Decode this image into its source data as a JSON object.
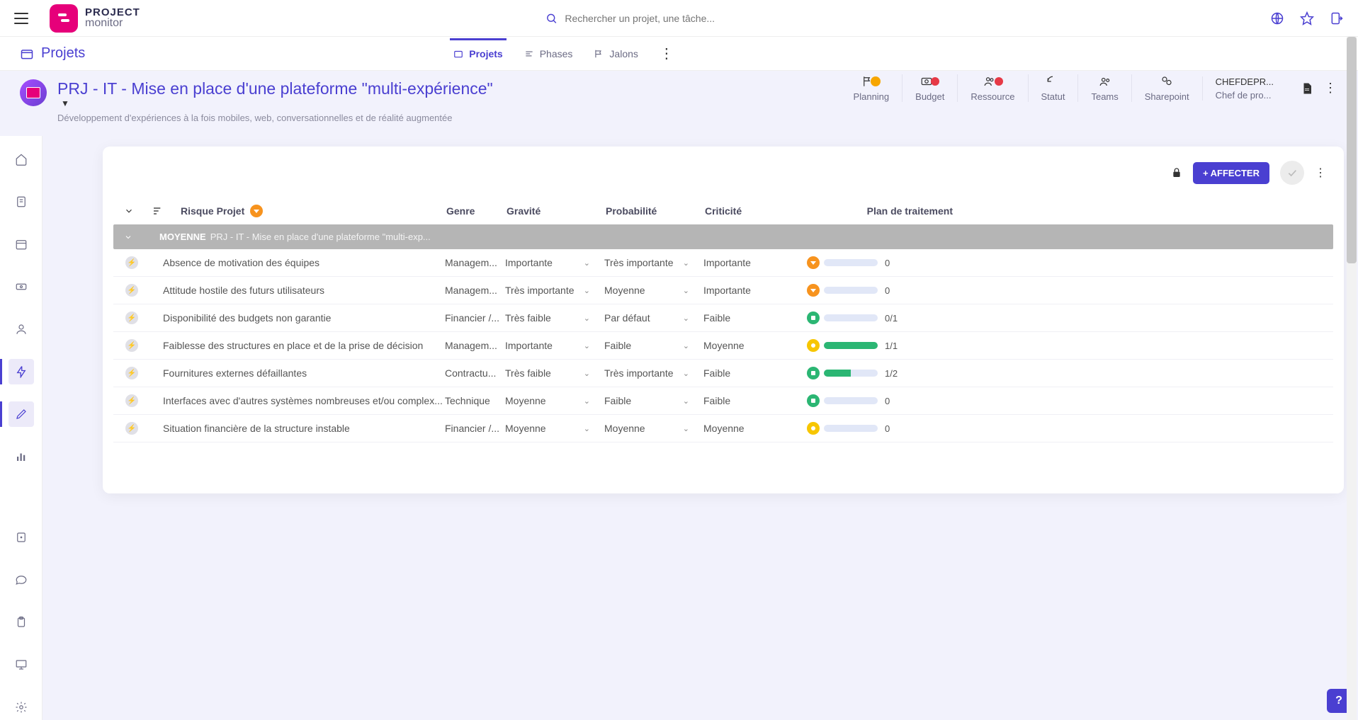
{
  "brand": {
    "line1": "PROJECT",
    "line2": "monitor"
  },
  "search": {
    "placeholder": "Rechercher un projet, une tâche..."
  },
  "crumb": {
    "label": "Projets"
  },
  "tabs": {
    "projects": "Projets",
    "phases": "Phases",
    "milestones": "Jalons"
  },
  "project": {
    "title": "PRJ - IT - Mise en place d'une plateforme \"multi-expérience\"",
    "subtitle": "Développement d'expériences à la fois mobiles, web, conversationnelles et de réalité augmentée"
  },
  "actions": {
    "planning": "Planning",
    "budget": "Budget",
    "resource": "Ressource",
    "status": "Statut",
    "teams": "Teams",
    "sharepoint": "Sharepoint",
    "manager_name": "CHEFDEPR...",
    "manager_role": "Chef de pro..."
  },
  "panel": {
    "assign_btn": "+ AFFECTER",
    "columns": {
      "risk": "Risque Projet",
      "genre": "Genre",
      "severity": "Gravité",
      "probability": "Probabilité",
      "criticality": "Criticité",
      "plan": "Plan de traitement"
    },
    "group": {
      "level": "MOYENNE",
      "project": "PRJ - IT - Mise en place d'une plateforme \"multi-exp..."
    },
    "rows": [
      {
        "risk": "Absence de motivation des équipes",
        "genre": "Managem...",
        "severity": "Importante",
        "probability": "Très importante",
        "criticality": "Importante",
        "crit_color": "orange",
        "plan_pct": 0,
        "plan_label": "0"
      },
      {
        "risk": "Attitude hostile des futurs utilisateurs",
        "genre": "Managem...",
        "severity": "Très importante",
        "probability": "Moyenne",
        "criticality": "Importante",
        "crit_color": "orange",
        "plan_pct": 0,
        "plan_label": "0"
      },
      {
        "risk": "Disponibilité des budgets non garantie",
        "genre": "Financier /...",
        "severity": "Très faible",
        "probability": "Par défaut",
        "criticality": "Faible",
        "crit_color": "green",
        "plan_pct": 0,
        "plan_label": "0/1"
      },
      {
        "risk": "Faiblesse des structures en place et de la prise de décision",
        "genre": "Managem...",
        "severity": "Importante",
        "probability": "Faible",
        "criticality": "Moyenne",
        "crit_color": "yellow",
        "plan_pct": 100,
        "plan_label": "1/1"
      },
      {
        "risk": "Fournitures externes défaillantes",
        "genre": "Contractu...",
        "severity": "Très faible",
        "probability": "Très importante",
        "criticality": "Faible",
        "crit_color": "green",
        "plan_pct": 50,
        "plan_label": "1/2"
      },
      {
        "risk": "Interfaces avec d'autres systèmes nombreuses et/ou complex...",
        "genre": "Technique",
        "severity": "Moyenne",
        "probability": "Faible",
        "criticality": "Faible",
        "crit_color": "green",
        "plan_pct": 0,
        "plan_label": "0"
      },
      {
        "risk": "Situation financière de la structure instable",
        "genre": "Financier /...",
        "severity": "Moyenne",
        "probability": "Moyenne",
        "criticality": "Moyenne",
        "crit_color": "yellow",
        "plan_pct": 0,
        "plan_label": "0"
      }
    ]
  }
}
